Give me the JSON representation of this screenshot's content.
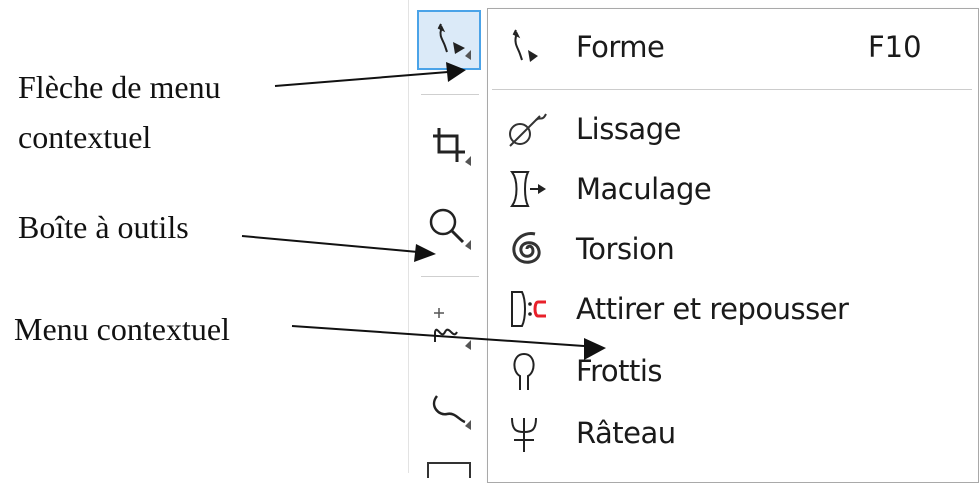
{
  "annotations": [
    {
      "text": "Flèche de menu"
    },
    {
      "text": "contextuel"
    },
    {
      "text": "Boîte à outils"
    },
    {
      "text": "Menu contextuel"
    }
  ],
  "toolbox": {
    "tools": [
      {
        "icon": "shape-tool-icon",
        "active": true
      },
      {
        "icon": "crop-tool-icon",
        "active": false
      },
      {
        "icon": "zoom-tool-icon",
        "active": false
      },
      {
        "icon": "curve-tool-icon",
        "active": false
      },
      {
        "icon": "artistic-media-icon",
        "active": false
      }
    ]
  },
  "flyout": {
    "items": [
      {
        "label": "Forme",
        "shortcut": "F10",
        "icon": "shape-icon"
      },
      {
        "label": "Lissage",
        "icon": "smooth-icon"
      },
      {
        "label": "Maculage",
        "icon": "smear-icon"
      },
      {
        "label": "Torsion",
        "icon": "twirl-icon"
      },
      {
        "label": "Attirer et repousser",
        "icon": "attract-repel-icon"
      },
      {
        "label": "Frottis",
        "icon": "smudge-icon"
      },
      {
        "label": "Râteau",
        "icon": "roughen-icon"
      }
    ]
  },
  "colors": {
    "active_tool_bg": "#dbeaf8",
    "active_tool_border": "#4aa3e8",
    "repel_accent": "#e8202a"
  }
}
